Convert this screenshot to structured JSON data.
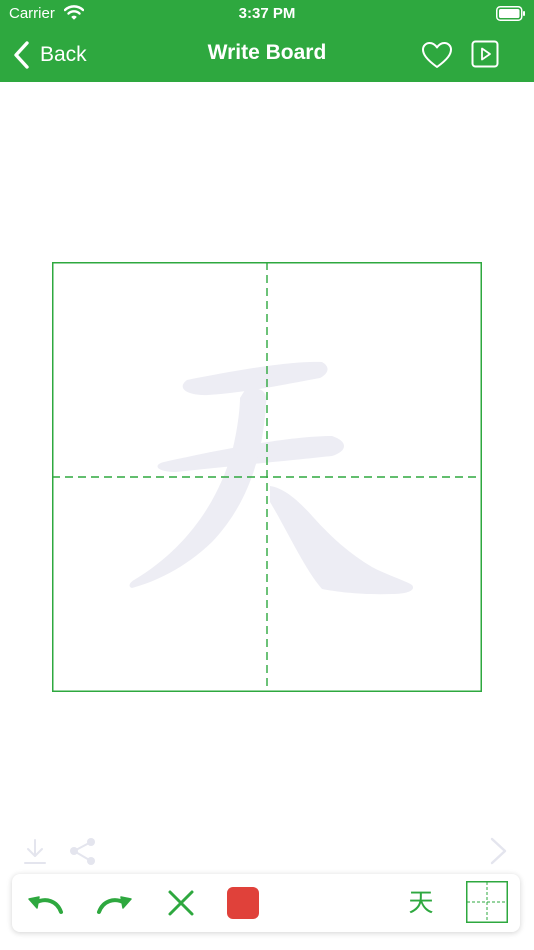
{
  "status_bar": {
    "carrier": "Carrier",
    "time": "3:37 PM",
    "wifi_icon": "wifi-icon",
    "battery_icon": "battery-icon"
  },
  "nav": {
    "back_label": "Back",
    "title": "Write Board",
    "favorite_icon": "heart-outline-icon",
    "play_icon": "play-square-icon"
  },
  "board": {
    "character": "天",
    "grid_color": "#2ea83f",
    "character_color": "#ededf4"
  },
  "tools": {
    "download_icon": "download-icon",
    "share_icon": "share-icon",
    "next_icon": "chevron-right-icon"
  },
  "toolbar": {
    "undo_icon": "undo-icon",
    "redo_icon": "redo-icon",
    "clear_icon": "close-icon",
    "brush_color": "#e0413a",
    "character_label": "天",
    "grid_icon": "grid-icon"
  },
  "colors": {
    "accent": "#2ea83f",
    "disabled": "#e4e5ee"
  }
}
